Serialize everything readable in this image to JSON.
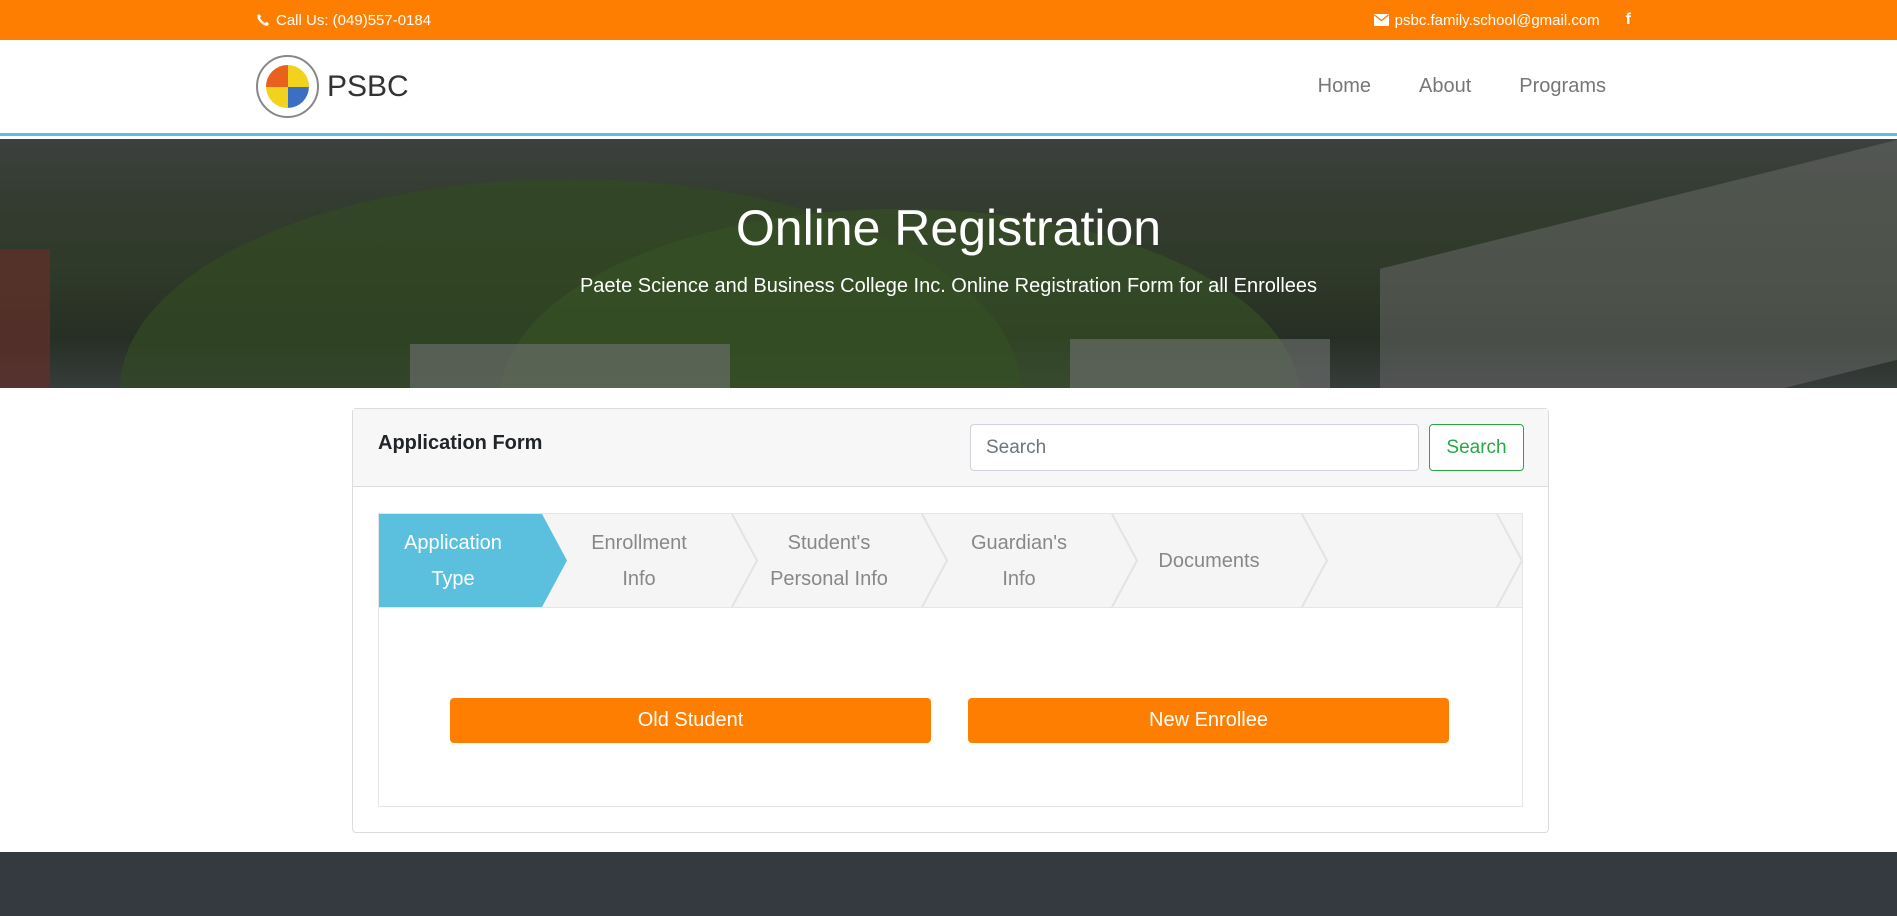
{
  "topbar": {
    "phone_icon": "phone-icon",
    "phone": "Call Us: (049)557-0184",
    "email_icon": "envelope-icon",
    "email": "psbc.family.school@gmail.com",
    "facebook_icon": "facebook-icon",
    "facebook_glyph": "f",
    "bg_color": "#fd7e00"
  },
  "navbar": {
    "brand": "PSBC",
    "items": [
      {
        "label": "Home"
      },
      {
        "label": "About"
      },
      {
        "label": "Programs"
      }
    ],
    "accent_color": "#5bc0de"
  },
  "hero": {
    "title": "Online Registration",
    "subtitle": "Paete Science and Business College Inc. Online Registration Form for all Enrollees"
  },
  "form": {
    "title": "Application Form",
    "search_placeholder": "Search",
    "search_button": "Search",
    "steps": [
      {
        "line1": "Application",
        "line2": "Type",
        "active": true
      },
      {
        "line1": "Enrollment",
        "line2": "Info",
        "active": false
      },
      {
        "line1": "Student's",
        "line2": "Personal Info",
        "active": false
      },
      {
        "line1": "Guardian's",
        "line2": "Info",
        "active": false
      },
      {
        "line1": "Documents",
        "line2": "",
        "active": false
      }
    ],
    "old_student_button": "Old Student",
    "new_enrollee_button": "New Enrollee",
    "button_color": "#fd7e00",
    "active_step_color": "#5bc0de"
  }
}
